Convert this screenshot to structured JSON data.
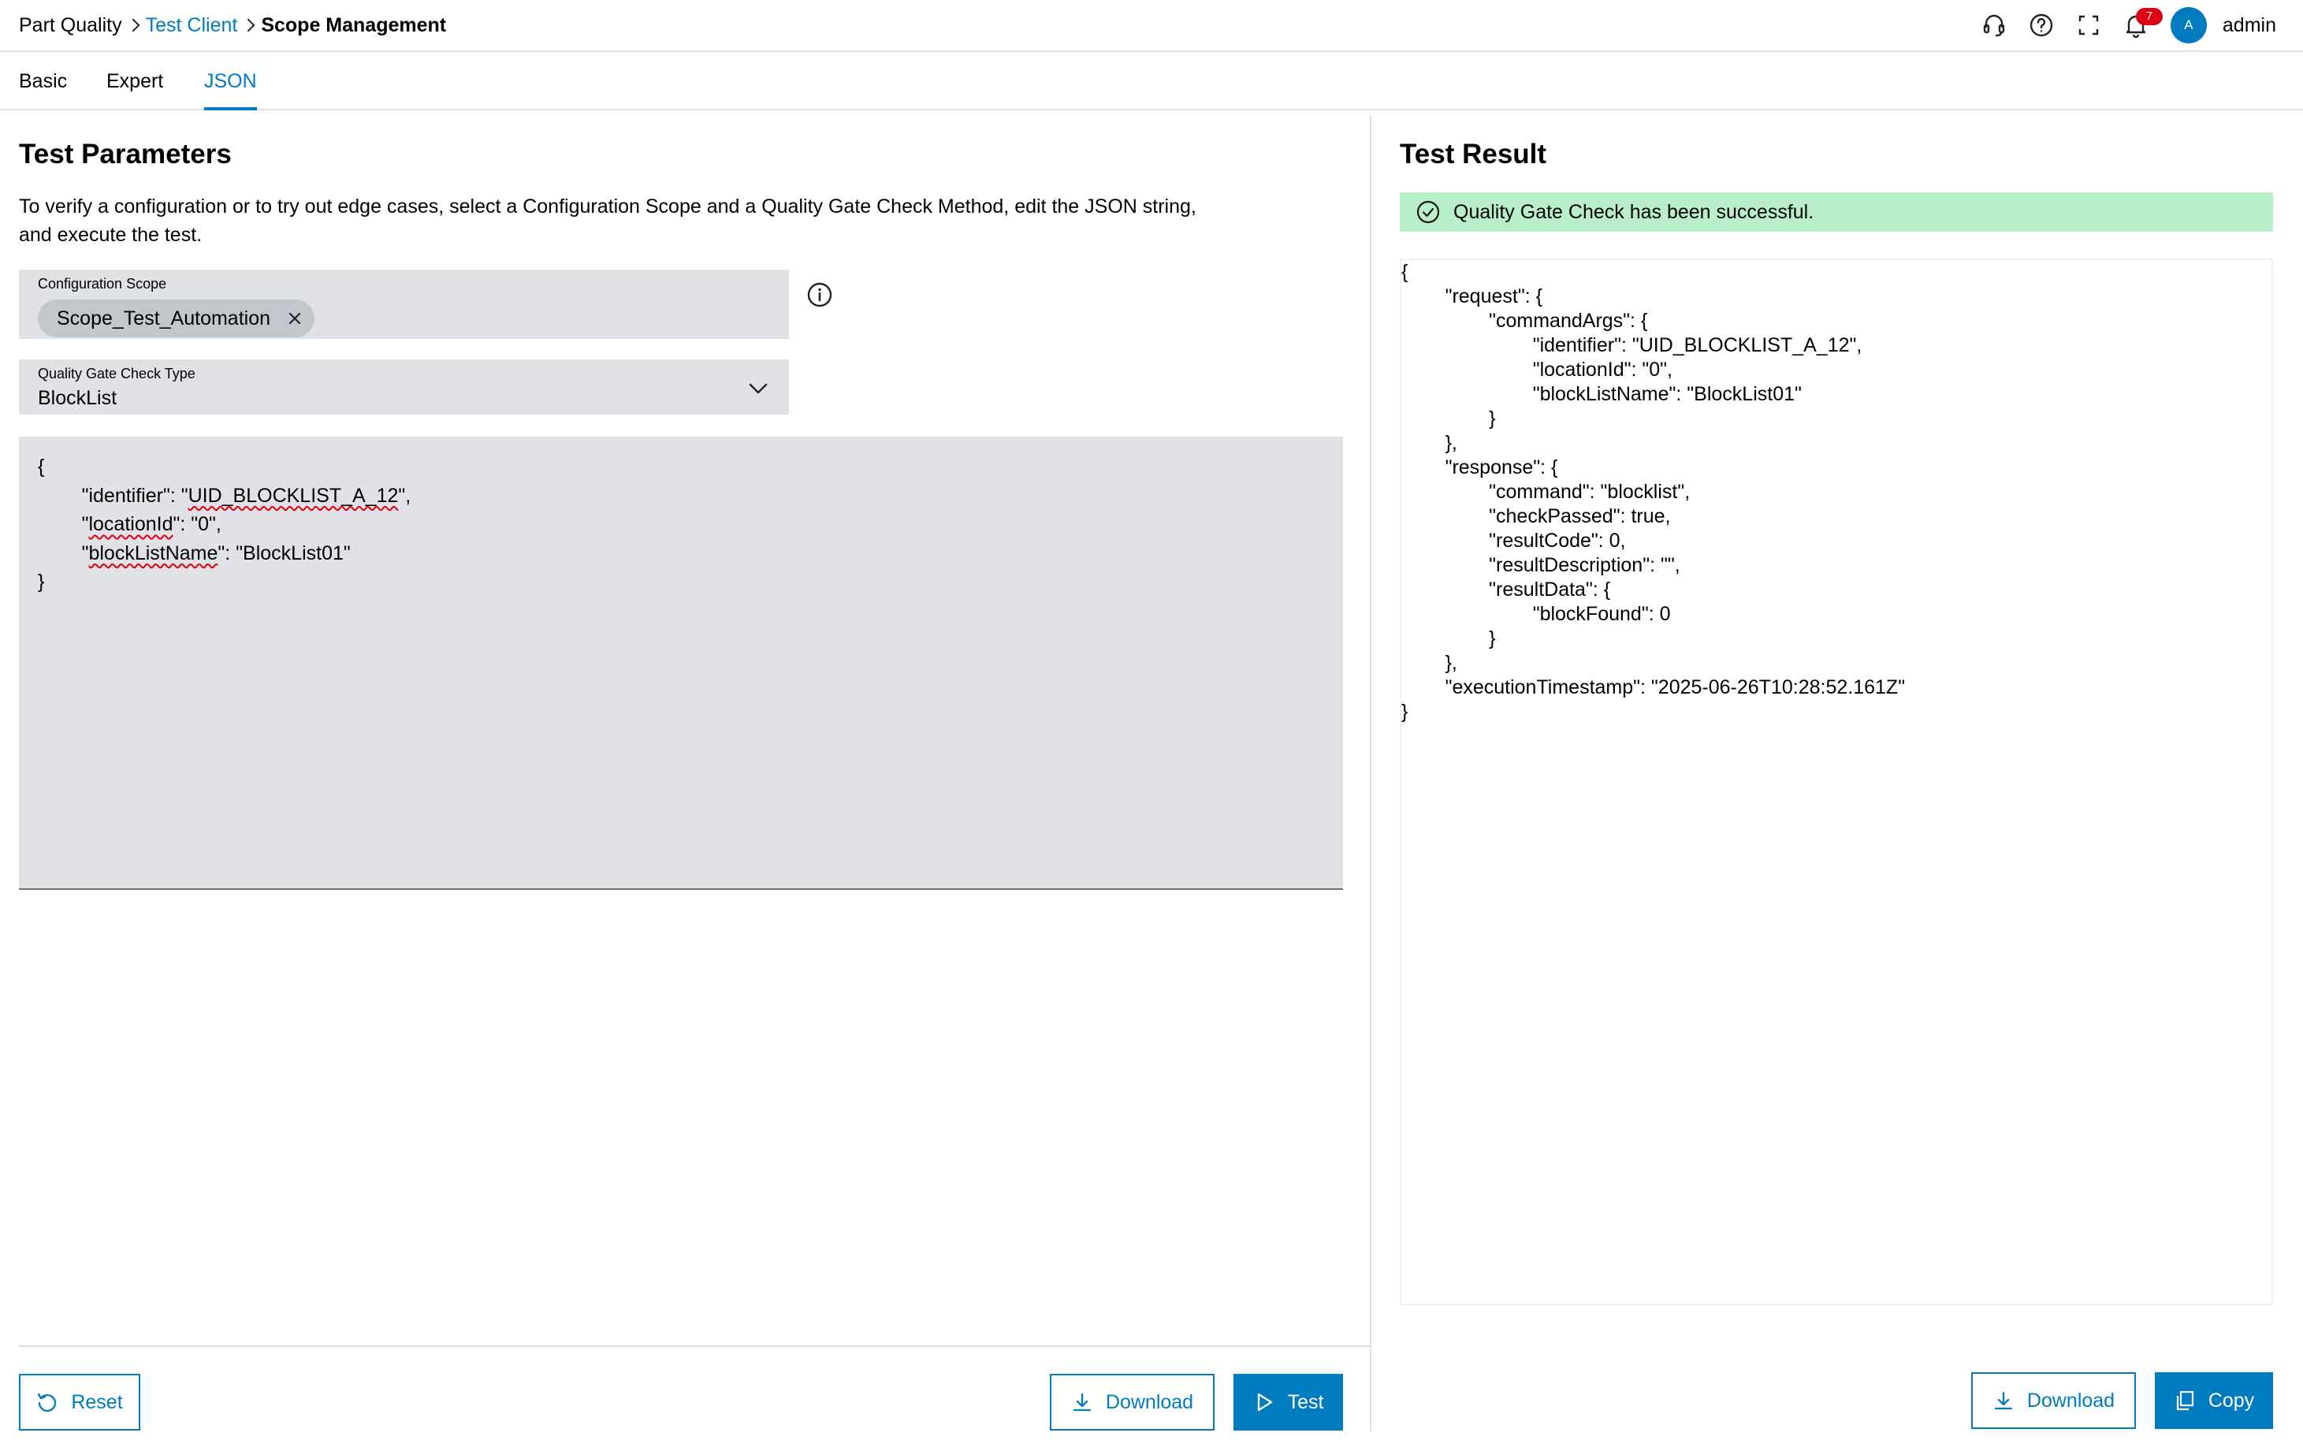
{
  "breadcrumb": {
    "items": [
      {
        "label": "Part Quality"
      },
      {
        "label": "Test Client"
      },
      {
        "label": "Scope Management"
      }
    ]
  },
  "header": {
    "notification_count": "7",
    "avatar_initial": "A",
    "user_name": "admin",
    "icons": [
      "headset-icon",
      "help-icon",
      "fullscreen-icon",
      "bell-icon"
    ]
  },
  "tabs": [
    {
      "label": "Basic",
      "active": false
    },
    {
      "label": "Expert",
      "active": false
    },
    {
      "label": "JSON",
      "active": true
    }
  ],
  "left": {
    "title": "Test Parameters",
    "description_line1": "To verify a configuration or to try out edge cases, select a Configuration Scope and a Quality Gate Check Method, edit the JSON string,",
    "description_line2": "and execute the test.",
    "scope_field": {
      "label": "Configuration Scope",
      "chip": "Scope_Test_Automation"
    },
    "check_type_field": {
      "label": "Quality Gate Check Type",
      "value": "BlockList"
    },
    "editor": {
      "line1": "{",
      "line2_indent": "        \"",
      "line2_key": "identifier",
      "line2_mid": "\": \"",
      "line2_val": "UID_BLOCKLIST_A_12",
      "line2_end": "\",",
      "line3_indent": "        \"",
      "line3_key": "locationId",
      "line3_end": "\": \"0\",",
      "line4_indent": "        \"",
      "line4_key": "blockListName",
      "line4_end": "\": \"BlockList01\"",
      "line5": "}"
    },
    "buttons": {
      "reset": "Reset",
      "download": "Download",
      "test": "Test"
    }
  },
  "right": {
    "title": "Test Result",
    "status_message": "Quality Gate Check has been successful.",
    "status_color": "#b8efc9",
    "result_lines": [
      "{",
      "        \"request\": {",
      "                \"commandArgs\": {",
      "                        \"identifier\": \"UID_BLOCKLIST_A_12\",",
      "                        \"locationId\": \"0\",",
      "                        \"blockListName\": \"BlockList01\"",
      "                }",
      "        },",
      "        \"response\": {",
      "                \"command\": \"blocklist\",",
      "                \"checkPassed\": true,",
      "                \"resultCode\": 0,",
      "                \"resultDescription\": \"\",",
      "                \"resultData\": {",
      "                        \"blockFound\": 0",
      "                }",
      "        },",
      "        \"executionTimestamp\": \"2025-06-26T10:28:52.161Z\"",
      "}"
    ],
    "buttons": {
      "download": "Download",
      "copy": "Copy"
    }
  },
  "colors": {
    "accent": "#007bc0",
    "badge": "#e00015",
    "field_bg": "#e0e2e5"
  }
}
